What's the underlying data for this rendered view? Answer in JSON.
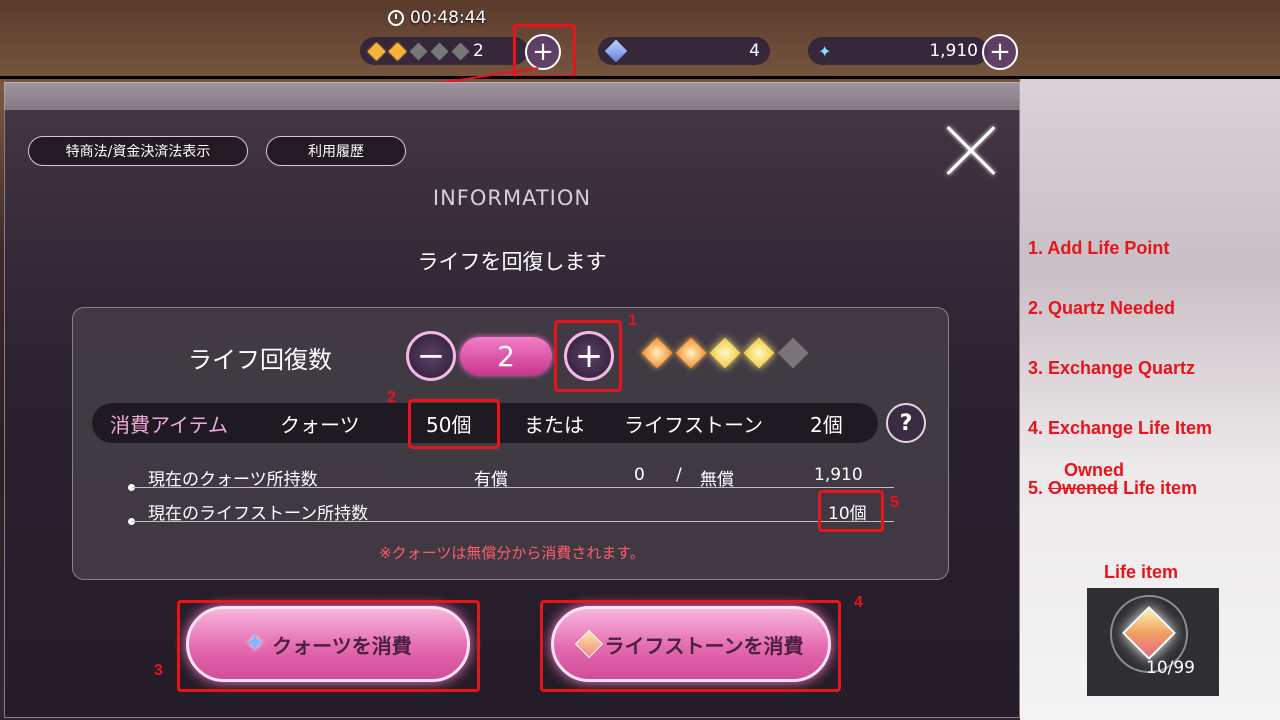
{
  "hud": {
    "timer": "00:48:44",
    "life_count": "2",
    "life_stars": [
      "full",
      "full",
      "off",
      "off",
      "off"
    ],
    "quartz": "4",
    "stars": "1,910",
    "plus_symbol": "+"
  },
  "dialog": {
    "btn_law": "特商法/資金決済法表示",
    "btn_history": "利用履歴",
    "title": "INFORMATION",
    "message": "ライフを回復します",
    "life_label": "ライフ回復数",
    "minus_symbol": "−",
    "plus_symbol": "+",
    "life_value": "2",
    "life_stars": [
      "full",
      "full",
      "gain",
      "gain",
      "off"
    ],
    "cost": {
      "label": "消費アイテム",
      "quartz_label": "クォーツ",
      "quartz_amount": "50個",
      "or": "または",
      "stone_label": "ライフストーン",
      "stone_amount": "2個"
    },
    "help_symbol": "?",
    "owned_quartz": {
      "label": "現在のクォーツ所持数",
      "paid_label": "有償",
      "paid_value": "0",
      "sep": "/",
      "free_label": "無償",
      "free_value": "1,910"
    },
    "owned_stone": {
      "label": "現在のライフストーン所持数",
      "value": "10個"
    },
    "note": "※クォーツは無償分から消費されます。",
    "btn_use_quartz": "クォーツを消費",
    "btn_use_stone": "ライフストーンを消費"
  },
  "annotations": {
    "n1": "1",
    "n2": "2",
    "n3": "3",
    "n4": "4",
    "n5": "5",
    "legend1": "1. Add Life Point",
    "legend2": "2. Quartz Needed",
    "legend3": "3. Exchange Quartz",
    "legend4": "4. Exchange Life Item",
    "legend5_owned": "Owned",
    "legend5_prefix": "5.",
    "legend5_struck": "Owened",
    "legend5_suffix": "Life item",
    "item_title": "Life item",
    "item_count": "10/99"
  },
  "colors": {
    "annotation": "#e8141c",
    "accent_pink": "#e46ab0"
  }
}
